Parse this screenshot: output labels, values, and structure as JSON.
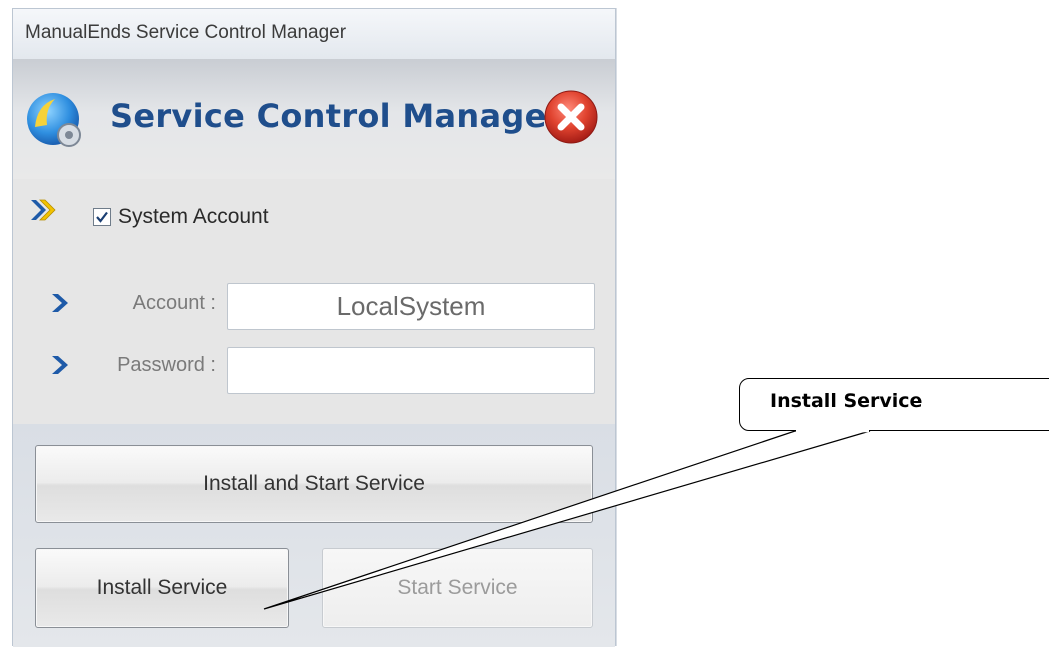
{
  "window": {
    "title": "ManualEnds Service Control Manager"
  },
  "header": {
    "heading": "Service Control Manager"
  },
  "form": {
    "system_account": {
      "label": "System Account",
      "checked": true
    },
    "account": {
      "label": "Account :",
      "value": "LocalSystem"
    },
    "password": {
      "label": "Password :",
      "value": ""
    }
  },
  "buttons": {
    "install_and_start": "Install and Start Service",
    "install": "Install Service",
    "start": "Start Service"
  },
  "annotation": {
    "callout_text": "Install Service"
  },
  "icons": {
    "app": "gear-app-icon",
    "close": "close-icon",
    "chevron_double": "double-chevron-icon",
    "chevron": "chevron-icon"
  },
  "colors": {
    "heading": "#1f4e8c",
    "close_red": "#d9342b",
    "chevron_yellow": "#f2c200",
    "chevron_blue": "#1e5aa8"
  }
}
